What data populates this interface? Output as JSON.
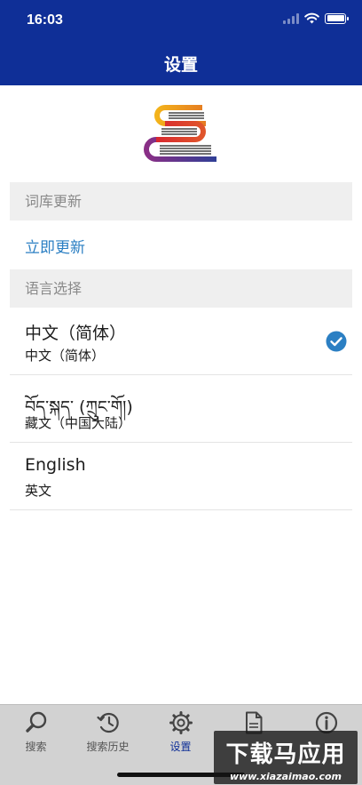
{
  "status_bar": {
    "time": "16:03"
  },
  "nav": {
    "title": "设置"
  },
  "sections": {
    "dictionary_update": "词库更新",
    "update_now": "立即更新",
    "language_select": "语言选择"
  },
  "languages": [
    {
      "main": "中文（简体）",
      "sub": "中文（简体）",
      "selected": true
    },
    {
      "main": "བོད་སྐད་ (ཀྲུང་གོ།)",
      "sub": "藏文（中国大陆）",
      "selected": false
    },
    {
      "main": "English",
      "sub": "英文",
      "selected": false
    }
  ],
  "tabbar": [
    {
      "label": "搜索",
      "icon": "search-icon",
      "active": false
    },
    {
      "label": "搜索历史",
      "icon": "history-icon",
      "active": false
    },
    {
      "label": "设置",
      "icon": "gear-icon",
      "active": true
    },
    {
      "label": "",
      "icon": "document-icon",
      "active": false
    },
    {
      "label": "",
      "icon": "info-icon",
      "active": false
    }
  ],
  "watermark": {
    "main": "下载马应用",
    "sub": "www.xiazaimao.com"
  },
  "colors": {
    "header": "#0f2f97",
    "link": "#2b7fc3",
    "check": "#2b7fc3",
    "tab_active": "#0f2f97"
  }
}
